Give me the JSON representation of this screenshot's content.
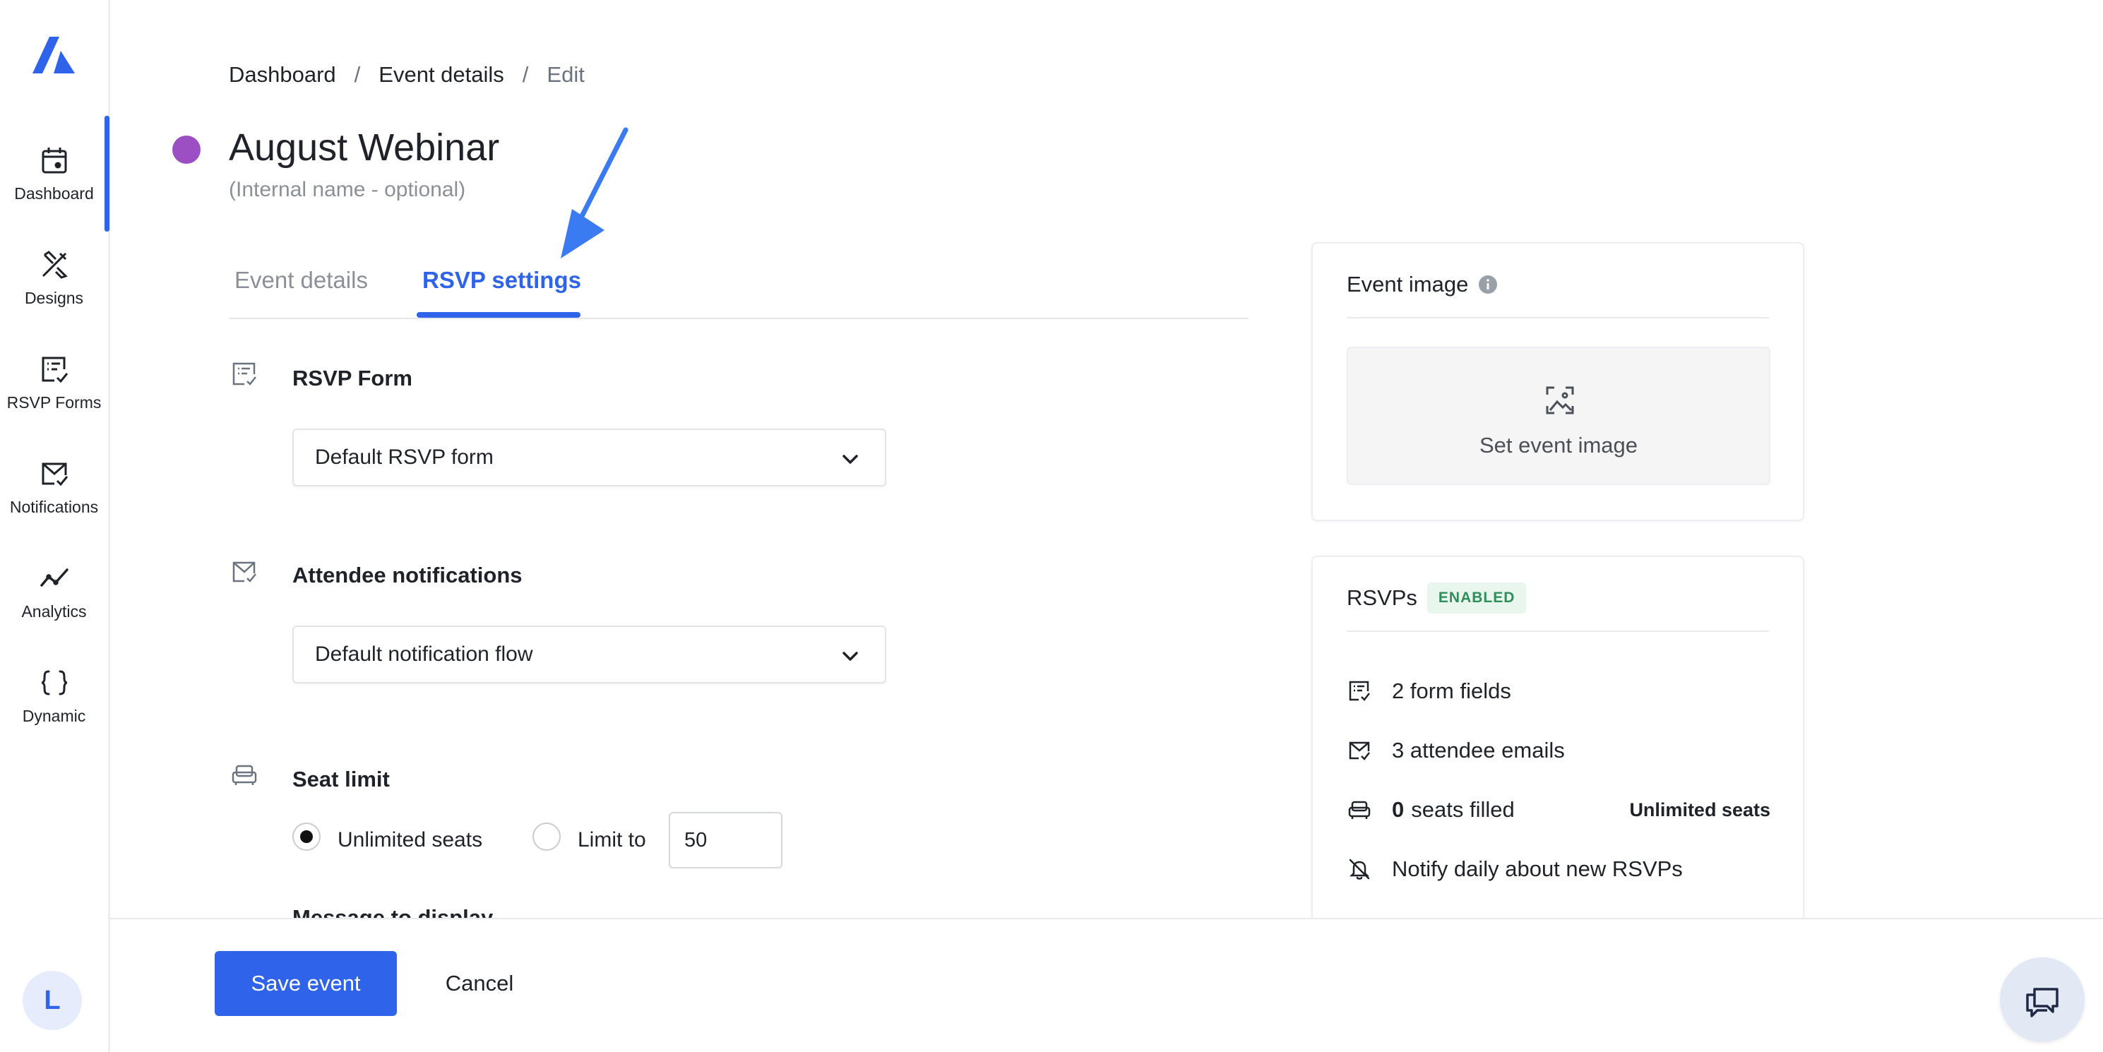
{
  "sidebar": {
    "items": [
      {
        "label": "Dashboard",
        "icon": "calendar-icon"
      },
      {
        "label": "Designs",
        "icon": "design-tools-icon"
      },
      {
        "label": "RSVP Forms",
        "icon": "form-check-icon"
      },
      {
        "label": "Notifications",
        "icon": "mail-check-icon"
      },
      {
        "label": "Analytics",
        "icon": "trend-line-icon"
      },
      {
        "label": "Dynamic",
        "icon": "braces-icon"
      }
    ],
    "active": "Dashboard",
    "avatar": "L"
  },
  "breadcrumb": {
    "items": [
      "Dashboard",
      "Event details",
      "Edit"
    ],
    "separator": "/"
  },
  "event": {
    "title": "August Webinar",
    "subtitle": "(Internal name - optional)",
    "color": "#9b4fc2"
  },
  "tabs": {
    "items": [
      "Event details",
      "RSVP settings"
    ],
    "active": "RSVP settings"
  },
  "rsvp_form": {
    "title": "RSVP Form",
    "selected": "Default RSVP form"
  },
  "attendee_notifications": {
    "title": "Attendee notifications",
    "selected": "Default notification flow"
  },
  "seat_limit": {
    "title": "Seat limit",
    "option_unlimited": "Unlimited seats",
    "option_limit": "Limit to",
    "limit_value": "50",
    "selected": "Unlimited seats",
    "message_label": "Message to display"
  },
  "event_image_card": {
    "title": "Event image",
    "placeholder": "Set event image"
  },
  "rsvps_card": {
    "title": "RSVPs",
    "badge": "ENABLED",
    "form_fields": "2 form fields",
    "attendee_emails": "3 attendee emails",
    "seats_filled_count": "0",
    "seats_filled_label": "seats filled",
    "seats_capacity": "Unlimited seats",
    "notify": "Notify daily about new RSVPs"
  },
  "footer": {
    "save_label": "Save event",
    "cancel_label": "Cancel"
  },
  "colors": {
    "accent": "#2f63ea",
    "badge_green": "#2f8f5b",
    "event_dot": "#9b4fc2"
  }
}
